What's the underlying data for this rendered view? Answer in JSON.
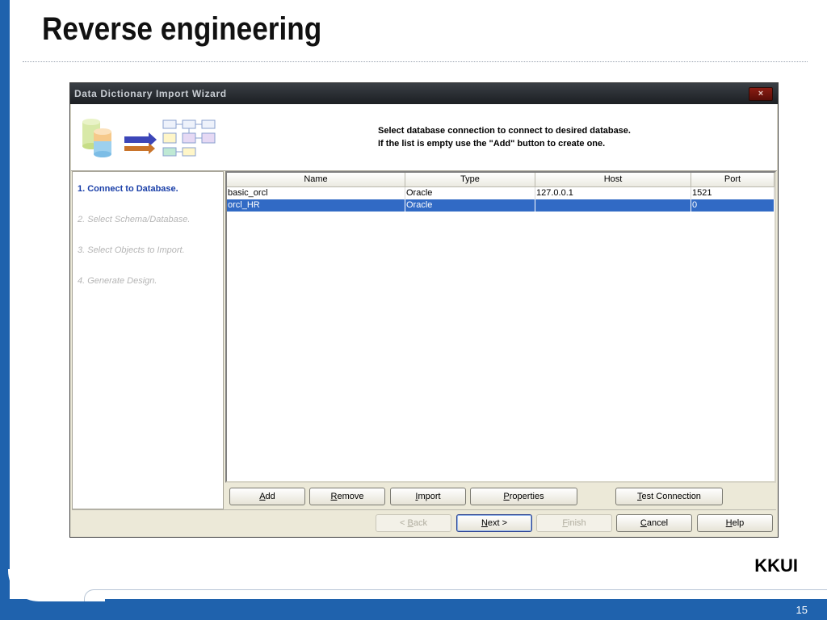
{
  "slide": {
    "title": "Reverse engineering",
    "brand": "KKUI",
    "page_number": "15"
  },
  "window": {
    "title": "Data Dictionary Import Wizard",
    "close_label": "×"
  },
  "header": {
    "line1": "Select database connection to connect to desired database.",
    "line2": "If the list is empty use the \"Add\" button to create one.",
    "icon": "database-import-icon"
  },
  "steps": [
    {
      "label": "1. Connect to Database.",
      "active": true
    },
    {
      "label": "2. Select Schema/Database.",
      "active": false
    },
    {
      "label": "3. Select Objects to Import.",
      "active": false
    },
    {
      "label": "4. Generate Design.",
      "active": false
    }
  ],
  "table": {
    "columns": [
      "Name",
      "Type",
      "Host",
      "Port"
    ],
    "rows": [
      {
        "name": "basic_orcl",
        "type": "Oracle",
        "host": "127.0.0.1",
        "port": "1521",
        "selected": false
      },
      {
        "name": "orcl_HR",
        "type": "Oracle",
        "host": "",
        "port": "0",
        "selected": true
      }
    ]
  },
  "actions": {
    "add": {
      "pre": "",
      "key": "A",
      "post": "dd"
    },
    "remove": {
      "pre": "",
      "key": "R",
      "post": "emove"
    },
    "import": {
      "pre": "",
      "key": "I",
      "post": "mport"
    },
    "properties": {
      "pre": "",
      "key": "P",
      "post": "roperties"
    },
    "test_connection": {
      "pre": "",
      "key": "T",
      "post": "est Connection"
    }
  },
  "nav": {
    "back": {
      "pre": "< ",
      "key": "B",
      "post": "ack"
    },
    "next": {
      "pre": "",
      "key": "N",
      "post": "ext >"
    },
    "finish": {
      "pre": "",
      "key": "F",
      "post": "inish"
    },
    "cancel": {
      "pre": "",
      "key": "C",
      "post": "ancel"
    },
    "help": {
      "pre": "",
      "key": "H",
      "post": "elp"
    }
  }
}
